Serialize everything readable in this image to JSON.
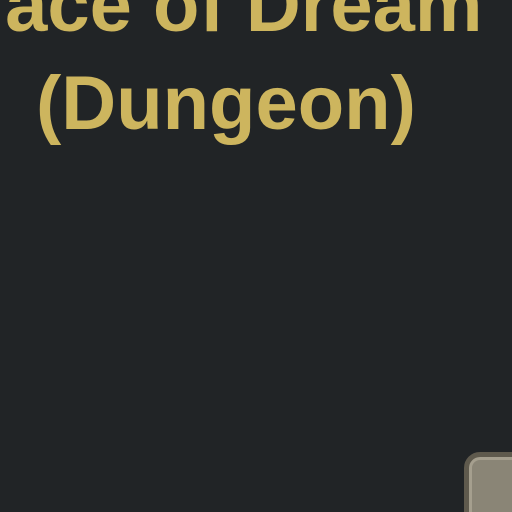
{
  "title": {
    "line1": "lace of Dream",
    "line2": "(Dungeon)"
  },
  "colors": {
    "background": "#212426",
    "title": "#cdb55e",
    "button_fill": "#8a8576",
    "button_border": "#5f5a4d"
  }
}
